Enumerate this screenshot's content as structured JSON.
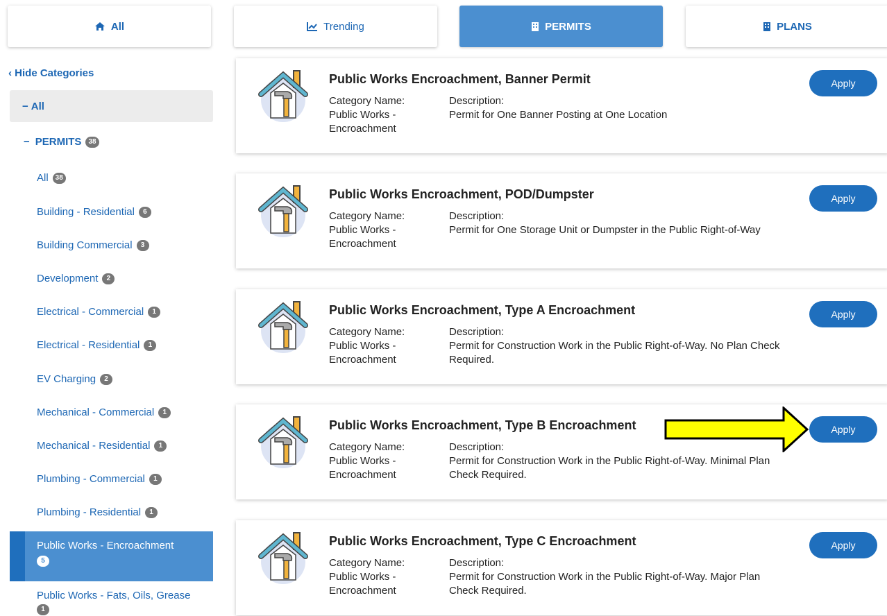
{
  "tabs": [
    {
      "label": "All",
      "icon": "home-icon",
      "active": false
    },
    {
      "label": "Trending",
      "icon": "chart-line-icon",
      "active": false
    },
    {
      "label": "PERMITS",
      "icon": "building-icon",
      "active": true
    },
    {
      "label": "PLANS",
      "icon": "building-icon",
      "active": false
    }
  ],
  "sidebar": {
    "hide_label": "Hide Categories",
    "all_label": "All",
    "permits_label": "PERMITS",
    "permits_count": "38",
    "items": [
      {
        "label": "All",
        "count": "38"
      },
      {
        "label": "Building - Residential",
        "count": "6"
      },
      {
        "label": "Building Commercial",
        "count": "3"
      },
      {
        "label": "Development",
        "count": "2"
      },
      {
        "label": "Electrical - Commercial",
        "count": "1"
      },
      {
        "label": "Electrical - Residential",
        "count": "1"
      },
      {
        "label": "EV Charging",
        "count": "2"
      },
      {
        "label": "Mechanical - Commercial",
        "count": "1"
      },
      {
        "label": "Mechanical - Residential",
        "count": "1"
      },
      {
        "label": "Plumbing - Commercial",
        "count": "1"
      },
      {
        "label": "Plumbing - Residential",
        "count": "1"
      }
    ],
    "active_item": {
      "label": "Public Works - Encroachment",
      "count": "5"
    },
    "next_item": {
      "label": "Public Works - Fats, Oils, Grease",
      "count": "1"
    }
  },
  "card_labels": {
    "category_label": "Category Name:",
    "description_label": "Description:",
    "apply_label": "Apply"
  },
  "permits": [
    {
      "title": "Public Works Encroachment, Banner Permit",
      "category": "Public Works - Encroachment",
      "description": "Permit for One Banner Posting at One Location"
    },
    {
      "title": "Public Works Encroachment, POD/Dumpster",
      "category": "Public Works - Encroachment",
      "description": "Permit for One Storage Unit or Dumpster in the Public Right-of-Way"
    },
    {
      "title": "Public Works Encroachment, Type A Encroachment",
      "category": "Public Works - Encroachment",
      "description": "Permit for Construction Work in the Public Right-of-Way. No Plan Check Required."
    },
    {
      "title": "Public Works Encroachment, Type B Encroachment",
      "category": "Public Works - Encroachment",
      "description": "Permit for Construction Work in the Public Right-of-Way. Minimal Plan Check Required."
    },
    {
      "title": "Public Works Encroachment, Type C Encroachment",
      "category": "Public Works - Encroachment",
      "description": "Permit for Construction Work in the Public Right-of-Way. Major Plan Check Required."
    }
  ],
  "colors": {
    "accent": "#1f6fbd",
    "active_tab": "#4b8fd0",
    "arrow": "#ffff00"
  }
}
